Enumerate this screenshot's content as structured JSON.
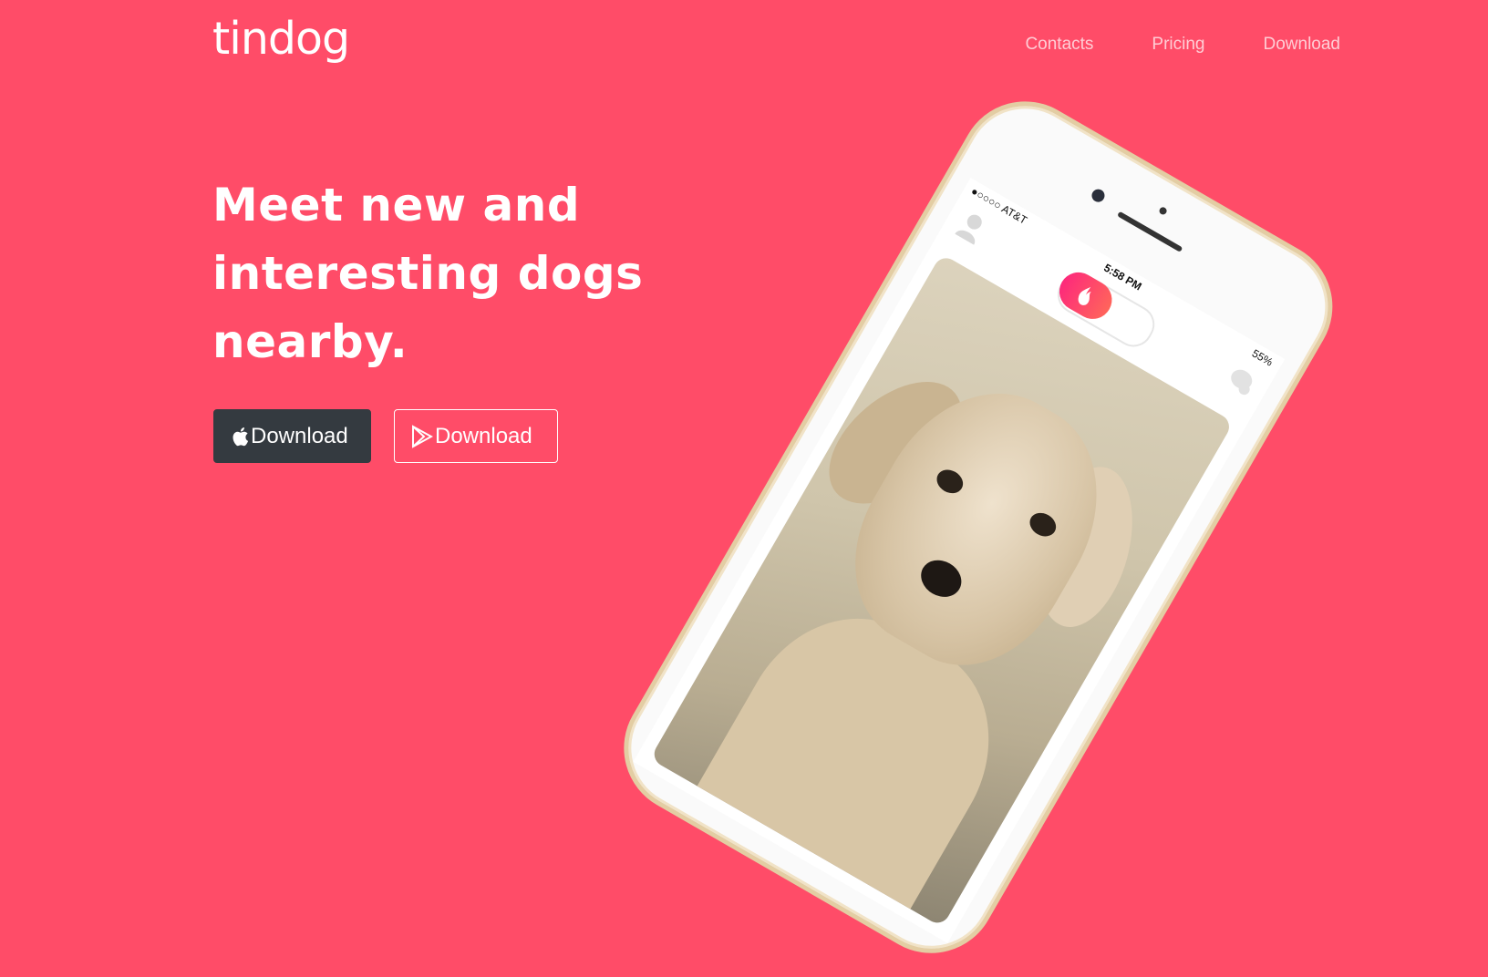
{
  "brand": {
    "name": "tindog"
  },
  "nav": {
    "items": [
      "Contacts",
      "Pricing",
      "Download"
    ]
  },
  "hero": {
    "headline_lines": [
      "Meet new and",
      "interesting dogs",
      "nearby."
    ],
    "apple_button_label": "Download",
    "google_button_label": "Download"
  },
  "phone": {
    "carrier": "●○○○○ AT&T",
    "time": "5:58 PM",
    "battery": "55%"
  },
  "colors": {
    "background": "#ff4c68",
    "dark_button": "#343a40",
    "toggle_gradient_start": "#fd297b",
    "toggle_gradient_end": "#ff655b"
  },
  "icons": [
    "apple-icon",
    "google-play-icon",
    "profile-icon",
    "flame-icon",
    "chat-icon"
  ]
}
